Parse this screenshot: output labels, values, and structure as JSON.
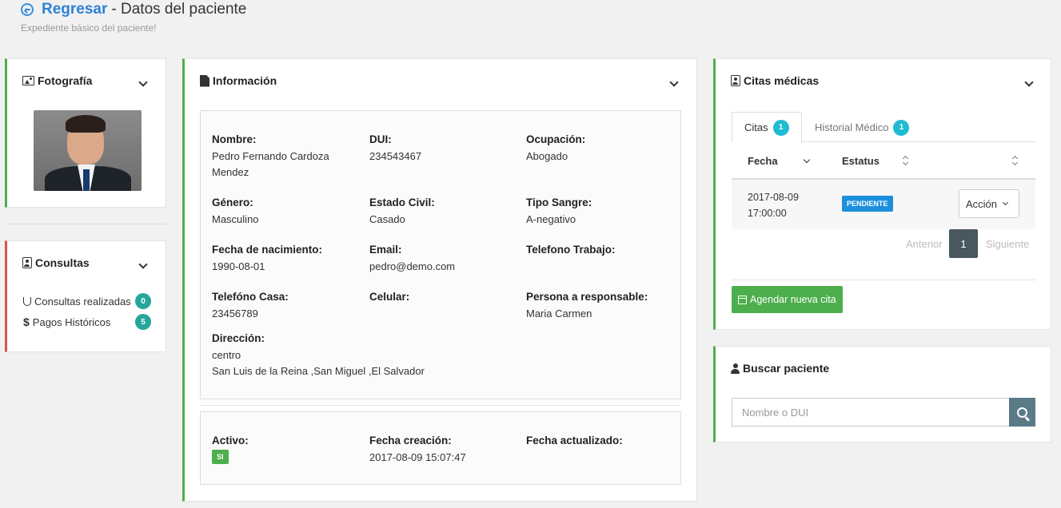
{
  "header": {
    "back_label": "Regresar",
    "title": "- Datos del paciente",
    "subtitle": "Expediente básico del paciente!"
  },
  "photo_panel": {
    "title": "Fotografía"
  },
  "consultas_panel": {
    "title": "Consultas",
    "items": [
      {
        "label": "Consultas realizadas",
        "count": "0"
      },
      {
        "label": "Pagos Históricos",
        "count": "5"
      }
    ]
  },
  "info_panel": {
    "title": "Información",
    "fields": {
      "nombre": {
        "label": "Nombre:",
        "value_line1": "Pedro Fernando Cardoza",
        "value_line2": "Mendez"
      },
      "dui": {
        "label": "DUI:",
        "value": "234543467"
      },
      "ocupacion": {
        "label": "Ocupación:",
        "value": "Abogado"
      },
      "genero": {
        "label": "Género:",
        "value": "Masculino"
      },
      "estado_civil": {
        "label": "Estado Civil:",
        "value": "Casado"
      },
      "tipo_sangre": {
        "label": "Tipo Sangre:",
        "value": "A-negativo"
      },
      "fecha_nacimiento": {
        "label": "Fecha de nacimiento:",
        "value": "1990-08-01"
      },
      "email": {
        "label": "Email:",
        "value": "pedro@demo.com"
      },
      "telefono_trabajo": {
        "label": "Telefono Trabajo:",
        "value": ""
      },
      "telefono_casa": {
        "label": "Telefóno Casa:",
        "value": "23456789"
      },
      "celular": {
        "label": "Celular:",
        "value": ""
      },
      "responsable": {
        "label": "Persona a responsable:",
        "value": "Maria Carmen"
      },
      "direccion": {
        "label": "Dirección:",
        "value_line1": "centro",
        "value_line2": "San Luis de la Reina ,San Miguel ,El Salvador"
      }
    },
    "meta": {
      "activo": {
        "label": "Activo:",
        "value": "SI"
      },
      "fecha_creacion": {
        "label": "Fecha creación:",
        "value": "2017-08-09 15:07:47"
      },
      "fecha_actualizado": {
        "label": "Fecha actualizado:",
        "value": ""
      }
    }
  },
  "citas_panel": {
    "title": "Citas médicas",
    "tabs": [
      {
        "label": "Citas",
        "count": "1"
      },
      {
        "label": "Historial Médico",
        "count": "1"
      }
    ],
    "columns": [
      "Fecha",
      "Estatus"
    ],
    "rows": [
      {
        "date": "2017-08-09",
        "time": "17:00:00",
        "status": "PENDIENTE",
        "action_label": "Acción"
      }
    ],
    "pagination": {
      "prev": "Anterior",
      "current": "1",
      "next": "Siguiente"
    },
    "new_button": "Agendar nueva cita"
  },
  "search_panel": {
    "title": "Buscar paciente",
    "placeholder": "Nombre o DUI"
  },
  "colors": {
    "accent_green": "#4cae4c",
    "accent_red": "#d9534f",
    "link_blue": "#2e82d6",
    "badge_teal": "#26a69a",
    "badge_cyan": "#1fbcd3",
    "status_blue": "#1c8fdd"
  }
}
